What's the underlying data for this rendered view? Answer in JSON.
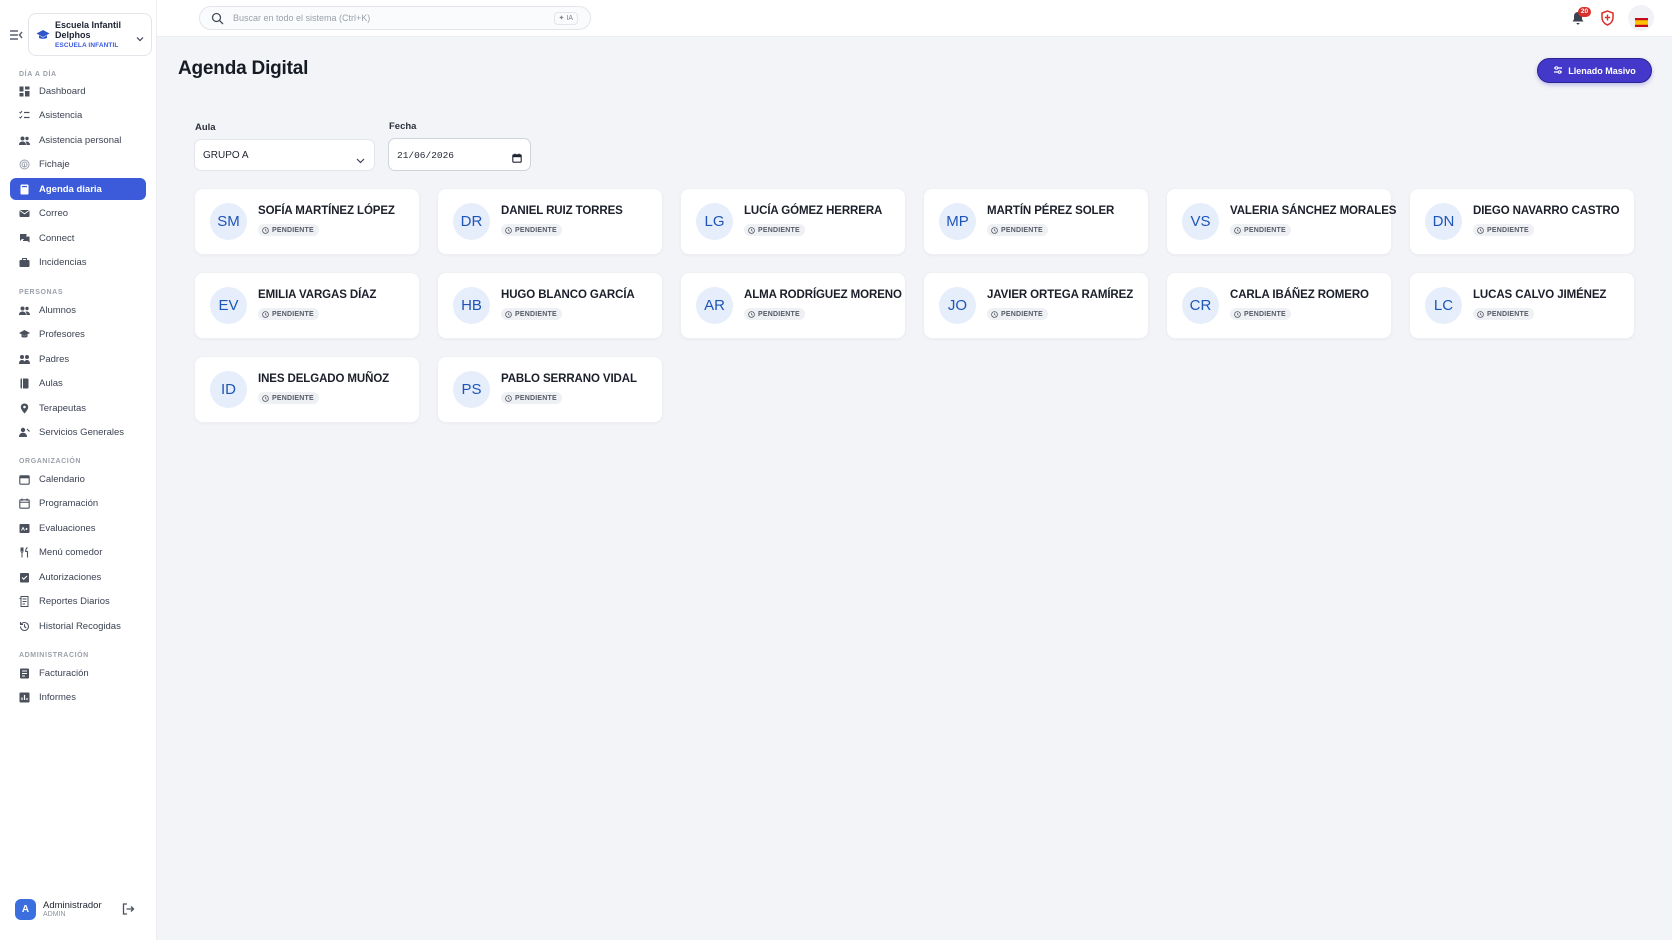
{
  "org": {
    "name": "Escuela Infantil Delphos",
    "type": "ESCUELA INFANTIL"
  },
  "sidebar": {
    "sections": [
      {
        "title": "DÍA A DÍA",
        "items": [
          {
            "label": "Dashboard",
            "icon": "dashboard-icon"
          },
          {
            "label": "Asistencia",
            "icon": "checklist-icon"
          },
          {
            "label": "Asistencia personal",
            "icon": "users-icon"
          },
          {
            "label": "Fichaje",
            "icon": "fingerprint-icon"
          },
          {
            "label": "Agenda diaria",
            "icon": "agenda-icon",
            "active": true
          },
          {
            "label": "Correo",
            "icon": "mail-icon"
          },
          {
            "label": "Connect",
            "icon": "chat-icon"
          },
          {
            "label": "Incidencias",
            "icon": "briefcase-icon"
          }
        ]
      },
      {
        "title": "PERSONAS",
        "items": [
          {
            "label": "Alumnos",
            "icon": "students-icon"
          },
          {
            "label": "Profesores",
            "icon": "graduation-cap-icon"
          },
          {
            "label": "Padres",
            "icon": "parents-icon"
          },
          {
            "label": "Aulas",
            "icon": "book-icon"
          },
          {
            "label": "Terapeutas",
            "icon": "location-pin-icon"
          },
          {
            "label": "Servicios Generales",
            "icon": "staff-icon"
          }
        ]
      },
      {
        "title": "ORGANIZACIÓN",
        "items": [
          {
            "label": "Calendario",
            "icon": "calendar-icon"
          },
          {
            "label": "Programación",
            "icon": "calendar-range-icon"
          },
          {
            "label": "Evaluaciones",
            "icon": "grades-icon"
          },
          {
            "label": "Menú comedor",
            "icon": "cutlery-icon"
          },
          {
            "label": "Autorizaciones",
            "icon": "approval-icon"
          },
          {
            "label": "Reportes Diarios",
            "icon": "report-icon"
          },
          {
            "label": "Historial Recogidas",
            "icon": "history-icon"
          }
        ]
      },
      {
        "title": "ADMINISTRACIÓN",
        "items": [
          {
            "label": "Facturación",
            "icon": "invoice-icon"
          },
          {
            "label": "Informes",
            "icon": "chart-report-icon"
          }
        ]
      }
    ]
  },
  "user": {
    "initial": "A",
    "name": "Administrador",
    "role": "ADMIN"
  },
  "topbar": {
    "search_placeholder": "Buscar en todo el sistema (Ctrl+K)",
    "ia_label": "IA",
    "notifications_count": "20"
  },
  "page": {
    "title": "Agenda Digital",
    "bulk_button": "Llenado Masivo"
  },
  "filters": {
    "aula_label": "Aula",
    "aula_value": "GRUPO A",
    "fecha_label": "Fecha",
    "fecha_value": "21/06/2026"
  },
  "students": [
    {
      "initials": "SM",
      "name": "SOFÍA MARTÍNEZ LÓPEZ",
      "status": "PENDIENTE"
    },
    {
      "initials": "DR",
      "name": "DANIEL RUIZ TORRES",
      "status": "PENDIENTE"
    },
    {
      "initials": "LG",
      "name": "LUCÍA GÓMEZ HERRERA",
      "status": "PENDIENTE"
    },
    {
      "initials": "MP",
      "name": "MARTÍN PÉREZ SOLER",
      "status": "PENDIENTE"
    },
    {
      "initials": "VS",
      "name": "VALERIA SÁNCHEZ MORALES",
      "status": "PENDIENTE"
    },
    {
      "initials": "DN",
      "name": "DIEGO NAVARRO CASTRO",
      "status": "PENDIENTE"
    },
    {
      "initials": "EV",
      "name": "EMILIA VARGAS DÍAZ",
      "status": "PENDIENTE"
    },
    {
      "initials": "HB",
      "name": "HUGO BLANCO GARCÍA",
      "status": "PENDIENTE"
    },
    {
      "initials": "AR",
      "name": "ALMA RODRÍGUEZ MORENO",
      "status": "PENDIENTE"
    },
    {
      "initials": "JO",
      "name": "JAVIER ORTEGA RAMÍREZ",
      "status": "PENDIENTE"
    },
    {
      "initials": "CR",
      "name": "CARLA IBÁÑEZ ROMERO",
      "status": "PENDIENTE"
    },
    {
      "initials": "LC",
      "name": "LUCAS CALVO JIMÉNEZ",
      "status": "PENDIENTE"
    },
    {
      "initials": "ID",
      "name": "INES DELGADO MUÑOZ",
      "status": "PENDIENTE"
    },
    {
      "initials": "PS",
      "name": "PABLO SERRANO VIDAL",
      "status": "PENDIENTE"
    }
  ],
  "colors": {
    "accent": "#3b5bdb",
    "bulk_button": "#4338ca",
    "avatar_bg": "#e6eefb",
    "avatar_text": "#1e55b8",
    "badge": "#d9302c"
  }
}
